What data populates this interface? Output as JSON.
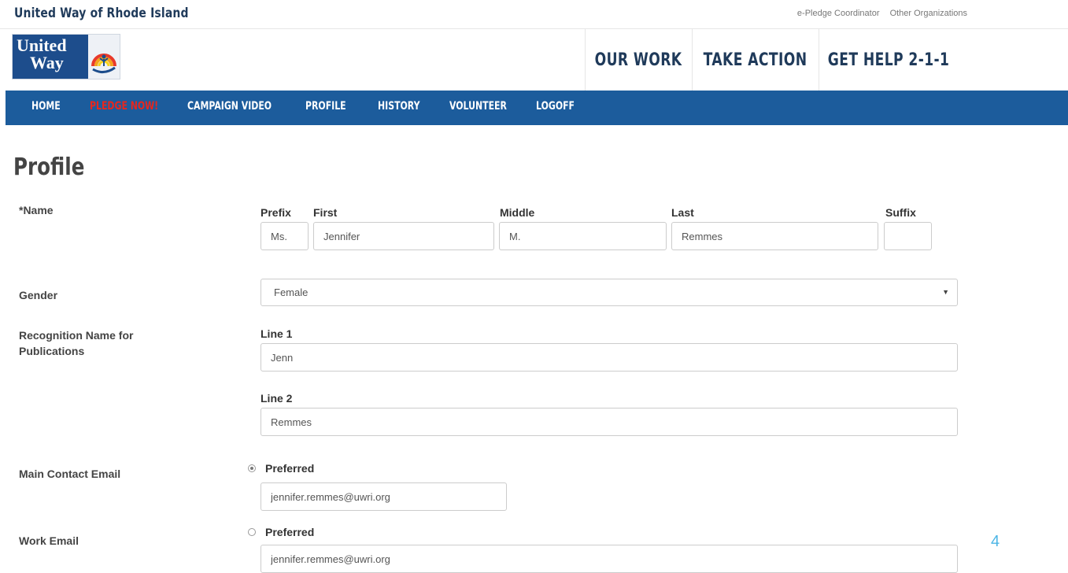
{
  "top_bar": {
    "org_title": "United Way of Rhode Island",
    "links": [
      "e-Pledge Coordinator",
      "Other Organizations"
    ]
  },
  "logo": {
    "line1": "United",
    "line2": "Way"
  },
  "header_nav": [
    "OUR WORK",
    "TAKE ACTION",
    "GET HELP 2-1-1"
  ],
  "main_nav": [
    "HOME",
    "PLEDGE NOW!",
    "CAMPAIGN VIDEO",
    "PROFILE",
    "HISTORY",
    "VOLUNTEER",
    "LOGOFF"
  ],
  "colors": {
    "nav_bar": "#1c5c9c",
    "pledge_link": "#e8261d",
    "brand_text": "#1f3a5a",
    "slide_number": "#4db6e6"
  },
  "page_title": "Profile",
  "form": {
    "name": {
      "label": "*Name",
      "prefix": {
        "label": "Prefix",
        "value": "Ms."
      },
      "first": {
        "label": "First",
        "value": "Jennifer"
      },
      "middle": {
        "label": "Middle",
        "value": "M."
      },
      "last": {
        "label": "Last",
        "value": "Remmes"
      },
      "suffix": {
        "label": "Suffix",
        "value": ""
      }
    },
    "gender": {
      "label": "Gender",
      "value": "Female"
    },
    "recognition": {
      "label_line1": "Recognition Name for",
      "label_line2": "Publications",
      "line1": {
        "label": "Line 1",
        "value": "Jenn"
      },
      "line2": {
        "label": "Line 2",
        "value": "Remmes"
      }
    },
    "main_email": {
      "label": "Main Contact Email",
      "preferred_label": "Preferred",
      "preferred": true,
      "value": "jennifer.remmes@uwri.org"
    },
    "work_email": {
      "label": "Work Email",
      "preferred_label": "Preferred",
      "preferred": false,
      "value": "jennifer.remmes@uwri.org"
    }
  },
  "slide_number": "4"
}
